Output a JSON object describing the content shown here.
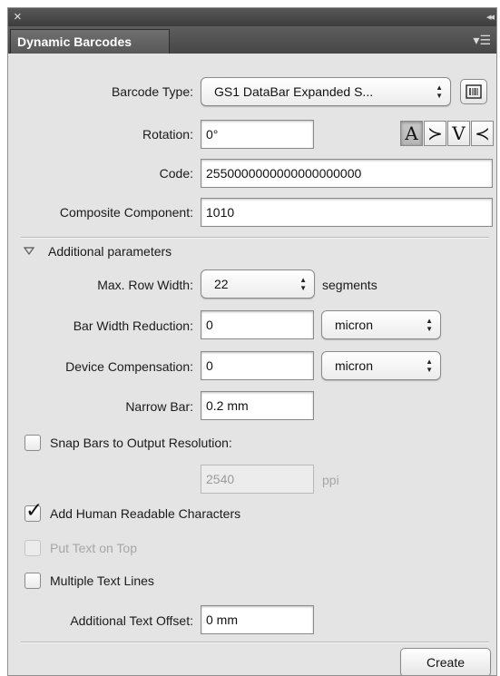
{
  "panel": {
    "title": "Dynamic Barcodes",
    "close_glyph": "×",
    "collapse_glyph": "◂◂",
    "menu_glyph": "▾☰"
  },
  "barcode_type": {
    "label": "Barcode Type:",
    "value": "GS1 DataBar Expanded S...",
    "settings_icon": "barcode-settings-icon"
  },
  "rotation": {
    "label": "Rotation:",
    "value": "0°",
    "buttons": [
      {
        "glyph": "A",
        "icon": "rotate-0-icon",
        "active": true
      },
      {
        "glyph": "≻",
        "icon": "rotate-90-icon",
        "active": false
      },
      {
        "glyph": "V",
        "icon": "rotate-180-icon",
        "active": false
      },
      {
        "glyph": "≺",
        "icon": "rotate-270-icon",
        "active": false
      }
    ]
  },
  "code": {
    "label": "Code:",
    "value": "2550000000000000000000"
  },
  "composite": {
    "label": "Composite Component:",
    "value": "1010"
  },
  "additional": {
    "header": "Additional parameters",
    "max_row_width": {
      "label": "Max. Row Width:",
      "value": "22",
      "unit": "segments"
    },
    "bar_width_reduction": {
      "label": "Bar Width Reduction:",
      "value": "0",
      "unit": "micron"
    },
    "device_compensation": {
      "label": "Device Compensation:",
      "value": "0",
      "unit": "micron"
    },
    "narrow_bar": {
      "label": "Narrow Bar:",
      "value": "0.2 mm"
    },
    "snap_bars": {
      "label": "Snap Bars to Output Resolution:",
      "checked": false
    },
    "resolution": {
      "value": "2540",
      "unit": "ppi",
      "disabled": true
    },
    "human_readable": {
      "label": "Add Human Readable Characters",
      "checked": true
    },
    "text_on_top": {
      "label": "Put Text on Top",
      "checked": false,
      "disabled": true
    },
    "multiple_lines": {
      "label": "Multiple Text Lines",
      "checked": false
    },
    "text_offset": {
      "label": "Additional Text Offset:",
      "value": "0 mm"
    }
  },
  "create_label": "Create",
  "colors": {
    "panel_bg": "#e4e4e4",
    "titlebar": "#3d3d3d",
    "tab": "#585858"
  }
}
